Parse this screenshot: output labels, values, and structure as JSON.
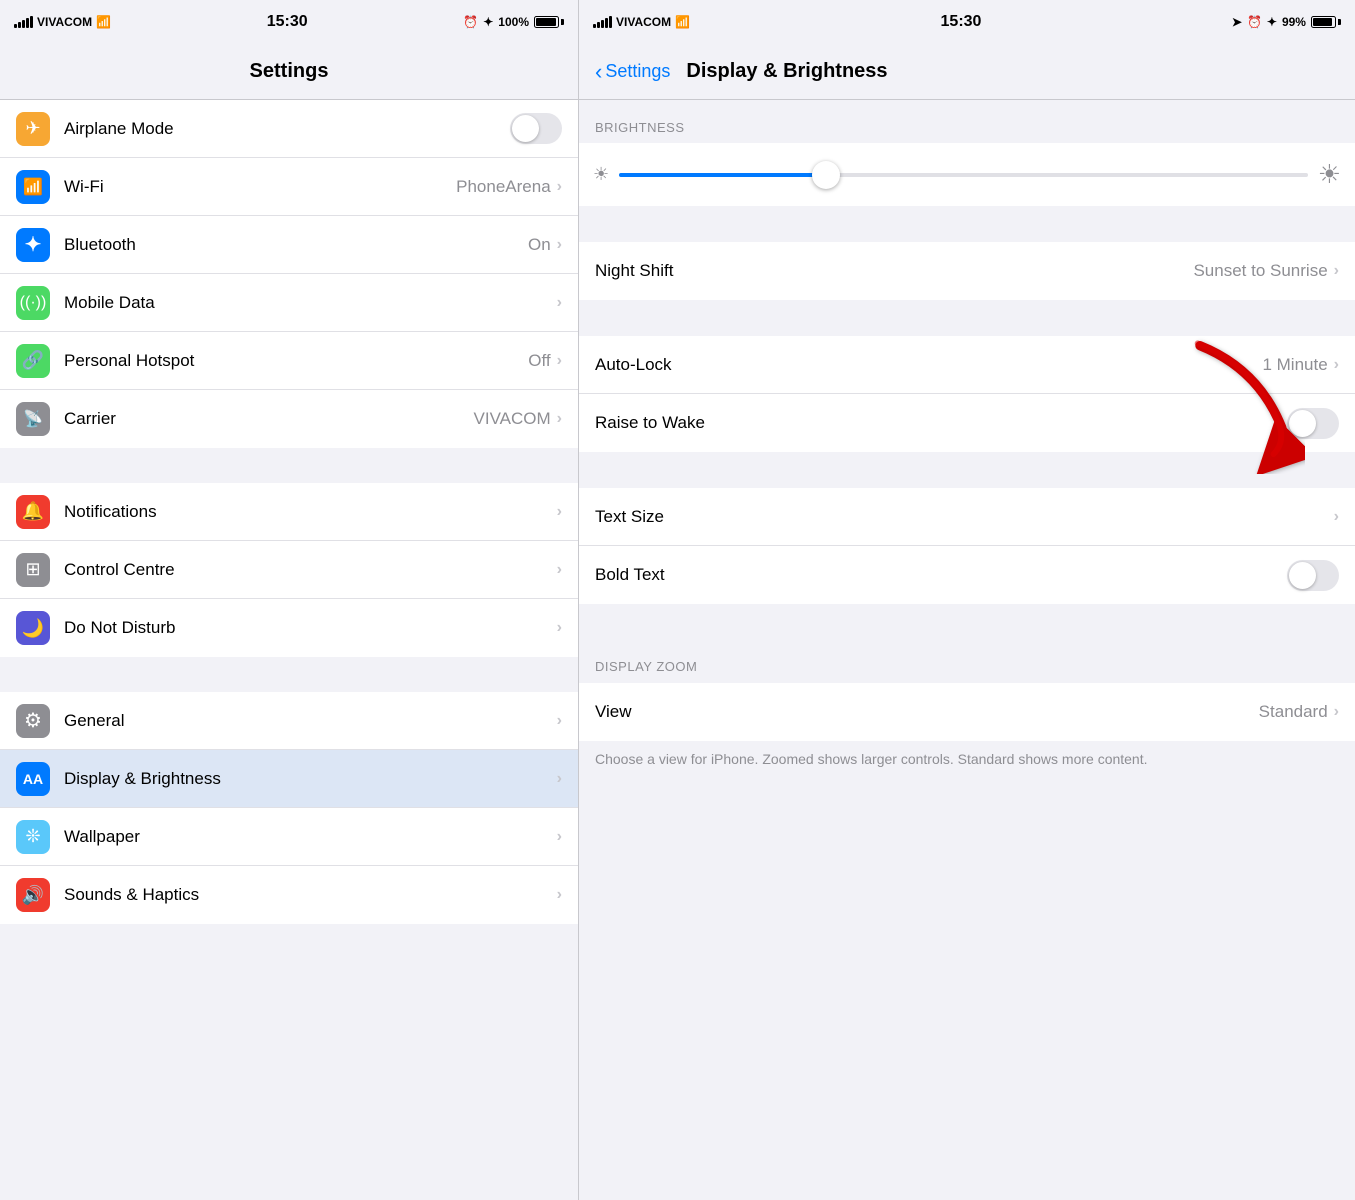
{
  "left": {
    "status": {
      "carrier": "VIVACOM",
      "signal": "●●●●",
      "wifi": "WiFi",
      "time": "15:30",
      "alarm": "⏰",
      "bluetooth": "✦",
      "battery": "100%"
    },
    "title": "Settings",
    "rows": [
      {
        "id": "airplane",
        "label": "Airplane Mode",
        "icon": "✈",
        "color": "#f7a733",
        "type": "toggle",
        "value": ""
      },
      {
        "id": "wifi",
        "label": "Wi-Fi",
        "icon": "📶",
        "color": "#007aff",
        "type": "chevron",
        "value": "PhoneArena"
      },
      {
        "id": "bluetooth",
        "label": "Bluetooth",
        "icon": "✦",
        "color": "#007aff",
        "type": "chevron",
        "value": "On"
      },
      {
        "id": "mobiledata",
        "label": "Mobile Data",
        "icon": "((·))",
        "color": "#4cd964",
        "type": "chevron",
        "value": ""
      },
      {
        "id": "hotspot",
        "label": "Personal Hotspot",
        "icon": "🔗",
        "color": "#4cd964",
        "type": "chevron",
        "value": "Off"
      },
      {
        "id": "carrier",
        "label": "Carrier",
        "icon": "📡",
        "color": "#8e8e93",
        "type": "chevron",
        "value": "VIVACOM"
      }
    ],
    "rows2": [
      {
        "id": "notifications",
        "label": "Notifications",
        "icon": "🔔",
        "color": "#f03b2e",
        "type": "chevron",
        "value": ""
      },
      {
        "id": "controlcentre",
        "label": "Control Centre",
        "icon": "⊞",
        "color": "#8e8e93",
        "type": "chevron",
        "value": ""
      },
      {
        "id": "donotdisturb",
        "label": "Do Not Disturb",
        "icon": "🌙",
        "color": "#5856d6",
        "type": "chevron",
        "value": ""
      }
    ],
    "rows3": [
      {
        "id": "general",
        "label": "General",
        "icon": "⚙",
        "color": "#8e8e93",
        "type": "chevron",
        "value": ""
      },
      {
        "id": "displaybrightness",
        "label": "Display & Brightness",
        "icon": "AA",
        "color": "#007aff",
        "type": "chevron",
        "value": "",
        "highlighted": true
      },
      {
        "id": "wallpaper",
        "label": "Wallpaper",
        "icon": "❊",
        "color": "#5ac8fa",
        "type": "chevron",
        "value": ""
      },
      {
        "id": "soundshaptics",
        "label": "Sounds & Haptics",
        "icon": "🔊",
        "color": "#f03b2e",
        "type": "chevron",
        "value": ""
      }
    ]
  },
  "right": {
    "status": {
      "carrier": "VIVACOM",
      "time": "15:30",
      "battery": "99%"
    },
    "back_label": "Settings",
    "title": "Display & Brightness",
    "brightness_section_header": "BRIGHTNESS",
    "brightness_value": 30,
    "rows_main": [
      {
        "id": "nightshift",
        "label": "Night Shift",
        "value": "Sunset to Sunrise",
        "type": "chevron"
      },
      {
        "id": "autolock",
        "label": "Auto-Lock",
        "value": "1 Minute",
        "type": "chevron"
      },
      {
        "id": "raisetowake",
        "label": "Raise to Wake",
        "value": "",
        "type": "toggle"
      },
      {
        "id": "textsize",
        "label": "Text Size",
        "value": "",
        "type": "chevron"
      },
      {
        "id": "boldtext",
        "label": "Bold Text",
        "value": "",
        "type": "toggle"
      }
    ],
    "zoom_section_header": "DISPLAY ZOOM",
    "rows_zoom": [
      {
        "id": "view",
        "label": "View",
        "value": "Standard",
        "type": "chevron"
      }
    ],
    "zoom_description": "Choose a view for iPhone. Zoomed shows larger controls. Standard shows more content."
  }
}
